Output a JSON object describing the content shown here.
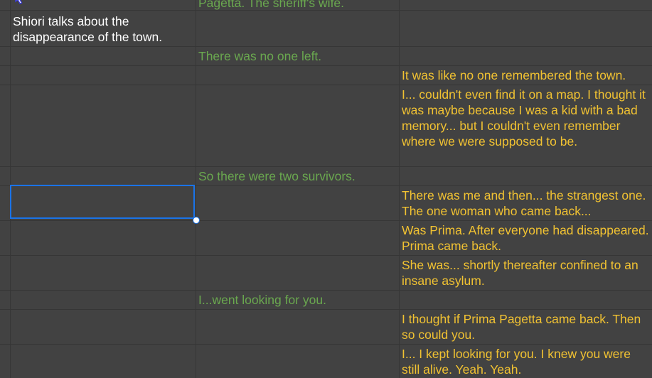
{
  "spreadsheet": {
    "rows": [
      {
        "col_a": "",
        "col_b": "Pagetta. The sheriff's wife.",
        "col_c": ""
      },
      {
        "col_a": "Shiori talks about the disappearance of the town.",
        "col_b": "",
        "col_c": ""
      },
      {
        "col_a": "",
        "col_b": "There was no one left.",
        "col_c": ""
      },
      {
        "col_a": "",
        "col_b": "",
        "col_c": "It was like no one remembered the town."
      },
      {
        "col_a": "",
        "col_b": "",
        "col_c": "I... couldn't even find it on a map. I thought it was maybe because I was a kid with a bad memory... but I couldn't even remember where we were supposed to be."
      },
      {
        "col_a": "",
        "col_b": "So there were two survivors.",
        "col_c": ""
      },
      {
        "col_a": "",
        "col_b": "",
        "col_c": "There was me and then... the strangest one. The one woman who came back..."
      },
      {
        "col_a": "",
        "col_b": "",
        "col_c": "Was Prima. After everyone had disappeared. Prima came back."
      },
      {
        "col_a": "",
        "col_b": "",
        "col_c": "She was... shortly thereafter confined to an insane asylum."
      },
      {
        "col_a": "",
        "col_b": "I...went looking for you.",
        "col_c": ""
      },
      {
        "col_a": "",
        "col_b": "",
        "col_c": "I thought if Prima Pagetta came back. Then so could you."
      },
      {
        "col_a": "",
        "col_b": "",
        "col_c": "I... I kept looking for you. I knew you were still alive. Yeah. Yeah."
      }
    ]
  },
  "colors": {
    "background": "#424242",
    "gridline": "#363636",
    "note_text": "#ffffff",
    "green_text": "#6aa84f",
    "yellow_text": "#f1c232",
    "selection": "#1a73e8"
  },
  "icons": {
    "cursor": "mouse-pointer-icon"
  }
}
